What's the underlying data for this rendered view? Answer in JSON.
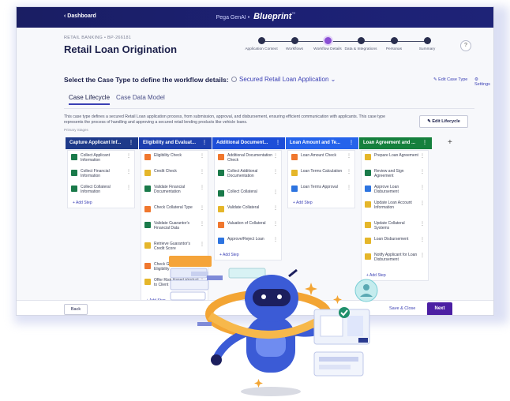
{
  "topbar": {
    "back_label": "‹ Dashboard",
    "brand_prefix": "Pega GenAI •",
    "brand": "Blueprint",
    "trademark": "™"
  },
  "header": {
    "breadcrumb": "RETAIL BANKING • BP-266181",
    "title": "Retail Loan Origination",
    "help_label": "?",
    "steps": [
      {
        "label": "Application Context",
        "active": false
      },
      {
        "label": "Workflows",
        "active": false
      },
      {
        "label": "Workflow Details",
        "active": true
      },
      {
        "label": "Data & Integrations",
        "active": false
      },
      {
        "label": "Personas",
        "active": false
      },
      {
        "label": "Summary",
        "active": false
      }
    ]
  },
  "case_type": {
    "question": "Select the Case Type to define the workflow details:",
    "selected": "Secured Retail Loan Application",
    "edit_label": "Edit Case Type",
    "settings_label": "Settings"
  },
  "tabs": [
    {
      "label": "Case Lifecycle",
      "active": true
    },
    {
      "label": "Case Data Model",
      "active": false
    }
  ],
  "lifecycle": {
    "description": "This case type defines a secured Retail Loan application process, from submission, approval, and disbursement, ensuring efficient communication with applicants. This case type represents the process of handling and approving a secured retail lending products like vehicle loans.",
    "primary_label": "Primary Stages",
    "edit_label": "Edit Lifecycle",
    "add_step_label": "+ Add Step",
    "add_stage_label": "+",
    "stages": [
      {
        "name": "Capture Applicant Inf...",
        "color": "#1e3a8a",
        "steps": [
          {
            "label": "Collect Applicant Information",
            "icon": "person-icon"
          },
          {
            "label": "Collect Financial Information",
            "icon": "person-icon"
          },
          {
            "label": "Collect Collateral Information",
            "icon": "person-icon"
          }
        ]
      },
      {
        "name": "Eligibility and Evaluat...",
        "color": "#1e40af",
        "steps": [
          {
            "label": "Eligibility Check",
            "icon": "cross-icon"
          },
          {
            "label": "Credit Check",
            "icon": "hand-icon"
          },
          {
            "label": "Validate Financial Documentation",
            "icon": "person-icon"
          },
          {
            "label": "Check Collateral Type",
            "icon": "cross-icon"
          },
          {
            "label": "Validate Guarantor's Financial Data",
            "icon": "person-icon"
          },
          {
            "label": "Retrieve Guarantor's Credit Score",
            "icon": "hand-icon"
          },
          {
            "label": "Check Guarantor Eligibility",
            "icon": "cross-icon"
          },
          {
            "label": "Offer Risk-Based Product to Client",
            "icon": "hand-icon"
          }
        ]
      },
      {
        "name": "Additional Document...",
        "color": "#1d4ed8",
        "steps": [
          {
            "label": "Additional Documentation Check",
            "icon": "cross-icon"
          },
          {
            "label": "Collect Additional Documentation",
            "icon": "person-icon"
          },
          {
            "label": "Collect Collateral",
            "icon": "person-icon"
          },
          {
            "label": "Validate Collateral",
            "icon": "hand-icon"
          },
          {
            "label": "Valuation of Collateral",
            "icon": "cross-icon"
          },
          {
            "label": "Approve/Reject Loan",
            "icon": "check-icon"
          }
        ]
      },
      {
        "name": "Loan Amount and Te...",
        "color": "#2563eb",
        "steps": [
          {
            "label": "Loan Amount Check",
            "icon": "cross-icon"
          },
          {
            "label": "Loan Terms Calculation",
            "icon": "hand-icon"
          },
          {
            "label": "Loan Terms Approval",
            "icon": "check-icon"
          }
        ]
      },
      {
        "name": "Loan Agreement and ...",
        "color": "#15803d",
        "steps": [
          {
            "label": "Prepare Loan Agreement",
            "icon": "hand-icon"
          },
          {
            "label": "Review and Sign Agreement",
            "icon": "person-icon"
          },
          {
            "label": "Approve Loan Disbursement",
            "icon": "check-icon"
          },
          {
            "label": "Update Loan Account Information",
            "icon": "hand-icon"
          },
          {
            "label": "Update Collateral Systems",
            "icon": "hand-icon"
          },
          {
            "label": "Loan Disbursement",
            "icon": "hand-icon"
          },
          {
            "label": "Notify Applicant for Loan Disbursement",
            "icon": "hand-icon"
          }
        ]
      }
    ]
  },
  "footer": {
    "back_label": "Back",
    "save_label": "Save & Close",
    "next_label": "Next"
  },
  "colors": {
    "topbar": "#1c2073",
    "accent": "#3a3fb4",
    "next_button": "#4b1fa3",
    "active_step": "#8a4fd4"
  }
}
